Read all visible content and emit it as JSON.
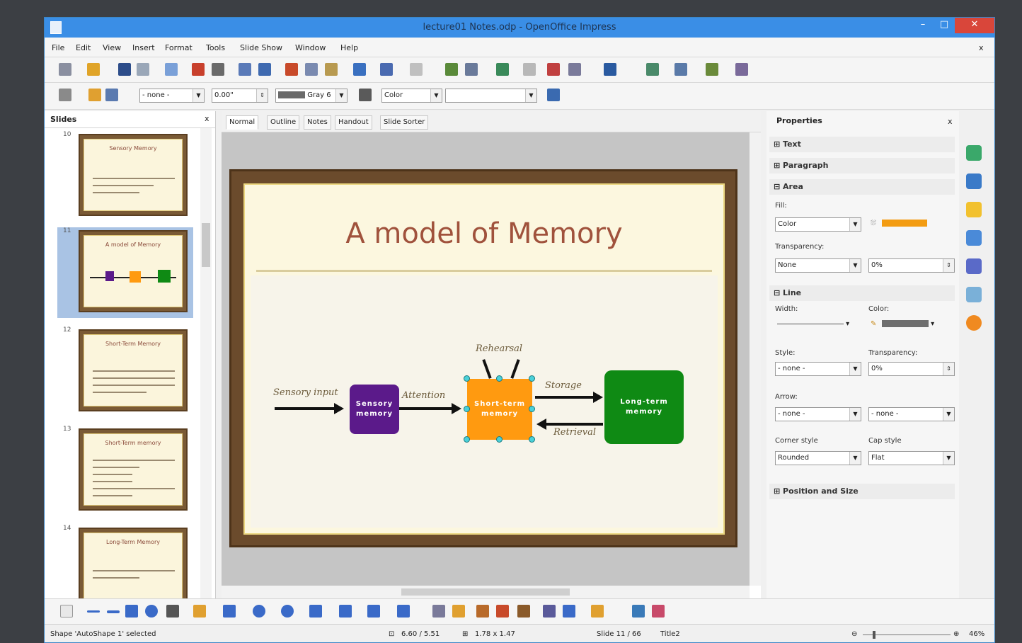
{
  "window": {
    "title": "lecture01 Notes.odp - OpenOffice Impress",
    "minimize": "–",
    "maximize": "□",
    "close": "✕"
  },
  "menu": {
    "items": [
      "File",
      "Edit",
      "View",
      "Insert",
      "Format",
      "Tools",
      "Slide Show",
      "Window",
      "Help"
    ],
    "close_doc": "x"
  },
  "line_toolbar": {
    "line_style": "- none -",
    "width": "0.00\"",
    "color_name": "Gray 6",
    "fill_mode": "Color",
    "fill_value": ""
  },
  "slides_panel": {
    "title": "Slides",
    "close": "x",
    "thumbnails": [
      {
        "num": "10",
        "title": "Sensory Memory"
      },
      {
        "num": "11",
        "title": "A model of Memory"
      },
      {
        "num": "12",
        "title": "Short-Term Memory"
      },
      {
        "num": "13",
        "title": "Short-Term memory"
      },
      {
        "num": "14",
        "title": "Long-Term Memory"
      }
    ]
  },
  "view_tabs": [
    "Normal",
    "Outline",
    "Notes",
    "Handout",
    "Slide Sorter"
  ],
  "slide": {
    "title": "A model of Memory",
    "labels": {
      "sensory_input": "Sensory input",
      "attention": "Attention",
      "rehearsal": "Rehearsal",
      "storage": "Storage",
      "retrieval": "Retrieval"
    },
    "boxes": {
      "sensory": "Sensory\nmemory",
      "short_term": "Short-term\nmemory",
      "long_term": "Long-term\nmemory"
    },
    "colors": {
      "sensory": "#5b1a8a",
      "short_term": "#ff9a10",
      "long_term": "#0f8a14"
    }
  },
  "properties": {
    "title": "Properties",
    "close": "x",
    "sections": {
      "text": "Text",
      "paragraph": "Paragraph",
      "area": "Area",
      "line": "Line",
      "position": "Position and Size"
    },
    "area": {
      "fill_label": "Fill:",
      "fill_value": "Color",
      "transparency_label": "Transparency:",
      "transparency_mode": "None",
      "transparency_value": "0%"
    },
    "line": {
      "width_label": "Width:",
      "color_label": "Color:",
      "style_label": "Style:",
      "style_value": "- none -",
      "transparency_label": "Transparency:",
      "transparency_value": "0%",
      "arrow_label": "Arrow:",
      "arrow_start": "- none -",
      "arrow_end": "- none -",
      "corner_label": "Corner style",
      "corner_value": "Rounded",
      "cap_label": "Cap style",
      "cap_value": "Flat"
    }
  },
  "status": {
    "selection": "Shape 'AutoShape 1' selected",
    "position": "6.60 / 5.51",
    "size": "1.78 x 1.47",
    "slide": "Slide 11 / 66",
    "layout": "Title2",
    "zoom": "46%"
  }
}
